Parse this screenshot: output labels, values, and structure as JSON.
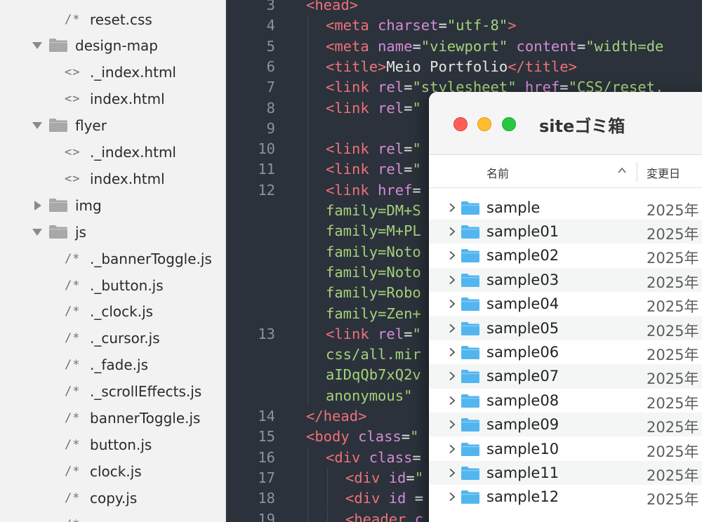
{
  "sidebar": {
    "items": [
      {
        "kind": "file",
        "glyph": "/*",
        "label": "reset.css"
      },
      {
        "kind": "folder-open",
        "label": "design-map"
      },
      {
        "kind": "file",
        "glyph": "<>",
        "label": "._index.html"
      },
      {
        "kind": "file",
        "glyph": "<>",
        "label": "index.html"
      },
      {
        "kind": "folder-open",
        "label": "flyer"
      },
      {
        "kind": "file",
        "glyph": "<>",
        "label": "._index.html"
      },
      {
        "kind": "file",
        "glyph": "<>",
        "label": "index.html"
      },
      {
        "kind": "folder-closed",
        "label": "img"
      },
      {
        "kind": "folder-open",
        "label": "js"
      },
      {
        "kind": "file",
        "glyph": "/*",
        "label": "._bannerToggle.js"
      },
      {
        "kind": "file",
        "glyph": "/*",
        "label": "._button.js"
      },
      {
        "kind": "file",
        "glyph": "/*",
        "label": "._clock.js"
      },
      {
        "kind": "file",
        "glyph": "/*",
        "label": "._cursor.js"
      },
      {
        "kind": "file",
        "glyph": "/*",
        "label": "._fade.js"
      },
      {
        "kind": "file",
        "glyph": "/*",
        "label": "._scrollEffects.js"
      },
      {
        "kind": "file",
        "glyph": "/*",
        "label": "bannerToggle.js"
      },
      {
        "kind": "file",
        "glyph": "/*",
        "label": "button.js"
      },
      {
        "kind": "file",
        "glyph": "/*",
        "label": "clock.js"
      },
      {
        "kind": "file",
        "glyph": "/*",
        "label": "copy.js"
      },
      {
        "kind": "file",
        "glyph": "/*",
        "label": ""
      }
    ]
  },
  "editor": {
    "lines": [
      {
        "num": "3",
        "indent": 0,
        "segs": [
          [
            "tag",
            "<head>"
          ]
        ]
      },
      {
        "num": "4",
        "indent": 1,
        "segs": [
          [
            "tag",
            "<meta "
          ],
          [
            "attr",
            "charset"
          ],
          [
            "txt",
            "="
          ],
          [
            "str",
            "\"utf-8\""
          ],
          [
            "tag",
            ">"
          ]
        ]
      },
      {
        "num": "5",
        "indent": 1,
        "segs": [
          [
            "tag",
            "<meta "
          ],
          [
            "attr",
            "name"
          ],
          [
            "txt",
            "="
          ],
          [
            "str",
            "\"viewport\""
          ],
          [
            "txt",
            " "
          ],
          [
            "attr",
            "content"
          ],
          [
            "txt",
            "="
          ],
          [
            "str",
            "\"width=de"
          ]
        ]
      },
      {
        "num": "6",
        "indent": 1,
        "segs": [
          [
            "tag",
            "<title>"
          ],
          [
            "txt",
            "Meio Portfolio"
          ],
          [
            "tag",
            "</title>"
          ]
        ]
      },
      {
        "num": "7",
        "indent": 1,
        "segs": [
          [
            "tag",
            "<link "
          ],
          [
            "attr",
            "rel"
          ],
          [
            "txt",
            "="
          ],
          [
            "str",
            "\"stylesheet\""
          ],
          [
            "txt",
            " "
          ],
          [
            "attr",
            "href"
          ],
          [
            "txt",
            "="
          ],
          [
            "str",
            "\"CSS/reset."
          ]
        ]
      },
      {
        "num": "8",
        "indent": 1,
        "segs": [
          [
            "tag",
            "<link "
          ],
          [
            "attr",
            "rel"
          ],
          [
            "txt",
            "="
          ],
          [
            "str",
            "\""
          ]
        ]
      },
      {
        "num": "9",
        "indent": 1,
        "segs": []
      },
      {
        "num": "10",
        "indent": 1,
        "segs": [
          [
            "tag",
            "<link "
          ],
          [
            "attr",
            "rel"
          ],
          [
            "txt",
            "="
          ],
          [
            "str",
            "\""
          ]
        ]
      },
      {
        "num": "11",
        "indent": 1,
        "segs": [
          [
            "tag",
            "<link "
          ],
          [
            "attr",
            "rel"
          ],
          [
            "txt",
            "="
          ],
          [
            "str",
            "\""
          ]
        ]
      },
      {
        "num": "12",
        "indent": 1,
        "segs": [
          [
            "tag",
            "<link "
          ],
          [
            "attr",
            "href"
          ],
          [
            "txt",
            "="
          ]
        ]
      },
      {
        "num": "",
        "indent": 1,
        "segs": [
          [
            "cont",
            "family=DM+S"
          ]
        ]
      },
      {
        "num": "",
        "indent": 1,
        "segs": [
          [
            "cont",
            "family=M+PL"
          ]
        ]
      },
      {
        "num": "",
        "indent": 1,
        "segs": [
          [
            "cont",
            "family=Noto"
          ]
        ]
      },
      {
        "num": "",
        "indent": 1,
        "segs": [
          [
            "cont",
            "family=Noto"
          ]
        ]
      },
      {
        "num": "",
        "indent": 1,
        "segs": [
          [
            "cont",
            "family=Robo"
          ]
        ]
      },
      {
        "num": "",
        "indent": 1,
        "segs": [
          [
            "cont",
            "family=Zen+"
          ]
        ]
      },
      {
        "num": "13",
        "indent": 1,
        "segs": [
          [
            "tag",
            "<link "
          ],
          [
            "attr",
            "rel"
          ],
          [
            "txt",
            "="
          ],
          [
            "str",
            "\""
          ]
        ]
      },
      {
        "num": "",
        "indent": 1,
        "segs": [
          [
            "cont",
            "css/all.mir"
          ]
        ]
      },
      {
        "num": "",
        "indent": 1,
        "segs": [
          [
            "cont",
            "aIDqQb7xQ2v"
          ]
        ]
      },
      {
        "num": "",
        "indent": 1,
        "segs": [
          [
            "cont",
            "anonymous\""
          ]
        ]
      },
      {
        "num": "14",
        "indent": 0,
        "segs": [
          [
            "tag",
            "</head>"
          ]
        ]
      },
      {
        "num": "15",
        "indent": 0,
        "segs": [
          [
            "tag",
            "<body "
          ],
          [
            "attr",
            "class"
          ],
          [
            "txt",
            "="
          ],
          [
            "str",
            "\""
          ]
        ]
      },
      {
        "num": "16",
        "indent": 1,
        "segs": [
          [
            "tag",
            "<div "
          ],
          [
            "attr",
            "class"
          ],
          [
            "txt",
            "="
          ]
        ]
      },
      {
        "num": "17",
        "indent": 2,
        "segs": [
          [
            "tag",
            "<div "
          ],
          [
            "attr",
            "id"
          ],
          [
            "txt",
            "="
          ],
          [
            "str",
            "\""
          ]
        ]
      },
      {
        "num": "18",
        "indent": 2,
        "segs": [
          [
            "tag",
            "<div "
          ],
          [
            "attr",
            "id"
          ],
          [
            "txt",
            " ="
          ]
        ]
      },
      {
        "num": "19",
        "indent": 2,
        "segs": [
          [
            "tag",
            "<header "
          ],
          [
            "attr",
            "c"
          ]
        ]
      }
    ]
  },
  "finder": {
    "title": "siteゴミ箱",
    "columns": {
      "name": "名前",
      "modified": "変更日"
    },
    "rows": [
      {
        "name": "sample",
        "date": "2025年"
      },
      {
        "name": "sample01",
        "date": "2025年"
      },
      {
        "name": "sample02",
        "date": "2025年"
      },
      {
        "name": "sample03",
        "date": "2025年"
      },
      {
        "name": "sample04",
        "date": "2025年"
      },
      {
        "name": "sample05",
        "date": "2025年"
      },
      {
        "name": "sample06",
        "date": "2025年"
      },
      {
        "name": "sample07",
        "date": "2025年"
      },
      {
        "name": "sample08",
        "date": "2025年"
      },
      {
        "name": "sample09",
        "date": "2025年"
      },
      {
        "name": "sample10",
        "date": "2025年"
      },
      {
        "name": "sample11",
        "date": "2025年"
      },
      {
        "name": "sample12",
        "date": "2025年"
      }
    ]
  },
  "colors": {
    "editor_bg": "#2b323b",
    "tag": "#f07178",
    "attr": "#d58bd6",
    "string": "#a5d27a",
    "folder_blue": "#52b5f0",
    "folder_gray": "#a8a8a8"
  }
}
